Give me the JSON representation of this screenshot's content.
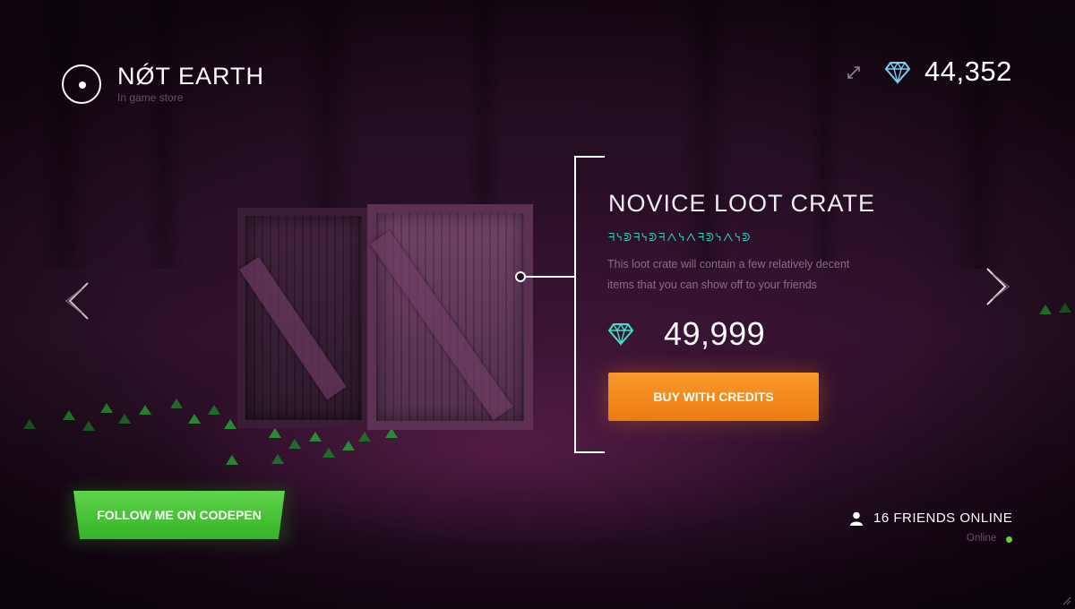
{
  "brand": {
    "title": "NǾT EARTH",
    "subtitle": "In game store"
  },
  "header": {
    "credits": "44,352",
    "icons": [
      "expand-icon",
      "diamond-icon"
    ]
  },
  "item": {
    "title": "NOVICE LOOT CRATE",
    "code": "ᖷᓭᕲᖷᓭᕲᖷᐱᓭᐱᖷᕲᓭᐱᓭᕲ",
    "description": "This loot crate will contain a few relatively decent items that you can show off to your friends",
    "price": "49,999",
    "buy_label": "BUY WITH CREDITS"
  },
  "nav": {
    "prev_icon": "chevron-left-icon",
    "next_icon": "chevron-right-icon"
  },
  "follow": {
    "label": "FOLLOW ME ON CODEPEN"
  },
  "friends": {
    "label": "16 FRIENDS ONLINE",
    "status": "Online"
  },
  "colors": {
    "accent_orange": "#f08518",
    "accent_green": "#48c434",
    "gem_blue": "#7dcdf0",
    "gem_teal": "#40e0c8",
    "online_green": "#5bd33e"
  }
}
